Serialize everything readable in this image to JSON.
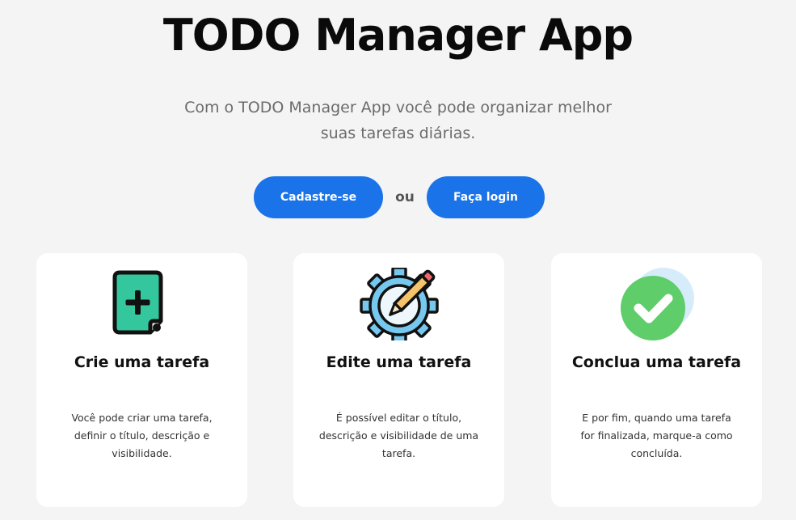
{
  "hero": {
    "title": "TODO Manager App",
    "subtitle": "Com o TODO Manager App você pode organizar melhor suas tarefas diárias."
  },
  "actions": {
    "signup_label": "Cadastre-se",
    "or_label": "ou",
    "login_label": "Faça login"
  },
  "features": [
    {
      "icon": "add-document-icon",
      "title": "Crie uma tarefa",
      "text": "Você pode criar uma tarefa, definir o título, descrição e visibilidade."
    },
    {
      "icon": "gear-pencil-icon",
      "title": "Edite uma tarefa",
      "text": "É possível editar o título, descrição e visibilidade de uma tarefa."
    },
    {
      "icon": "check-circle-icon",
      "title": "Conclua uma tarefa",
      "text": "E por fim, quando uma tarefa for finalizada, marque-a como concluída."
    }
  ],
  "colors": {
    "background": "#f4f4f4",
    "primary_button": "#1a73e8",
    "card": "#ffffff",
    "icon_green": "#34c79d",
    "check_green": "#5fcd6a"
  }
}
